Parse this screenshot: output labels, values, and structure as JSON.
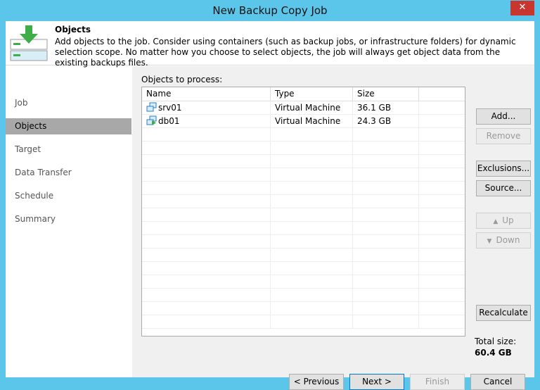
{
  "window": {
    "title": "New Backup Copy Job",
    "close_glyph": "✕"
  },
  "header": {
    "title": "Objects",
    "description": "Add objects to the job. Consider using containers (such as backup jobs, or infrastructure folders) for dynamic selection scope. No matter how you choose to select objects, the job will always get object data from the existing backups files."
  },
  "sidebar": {
    "items": [
      {
        "label": "Job"
      },
      {
        "label": "Objects"
      },
      {
        "label": "Target"
      },
      {
        "label": "Data Transfer"
      },
      {
        "label": "Schedule"
      },
      {
        "label": "Summary"
      }
    ]
  },
  "objects": {
    "label": "Objects to process:",
    "columns": [
      "Name",
      "Type",
      "Size"
    ],
    "rows": [
      {
        "name": "srv01",
        "type": "Virtual Machine",
        "size": "36.1 GB",
        "icon": "vm-icon"
      },
      {
        "name": "db01",
        "type": "Virtual Machine",
        "size": "24.3 GB",
        "icon": "vm-running-icon"
      }
    ]
  },
  "buttons": {
    "add": "Add...",
    "remove": "Remove",
    "exclusions": "Exclusions...",
    "source": "Source...",
    "up": "Up",
    "down": "Down",
    "recalculate": "Recalculate"
  },
  "total": {
    "label": "Total size:",
    "value": "60.4 GB"
  },
  "footer": {
    "previous": "< Previous",
    "next": "Next >",
    "finish": "Finish",
    "cancel": "Cancel"
  },
  "colors": {
    "titlebar": "#5bc6ea",
    "accent_green": "#3fae49",
    "selected_item": "#a8a8a8",
    "close": "#c7372f"
  }
}
